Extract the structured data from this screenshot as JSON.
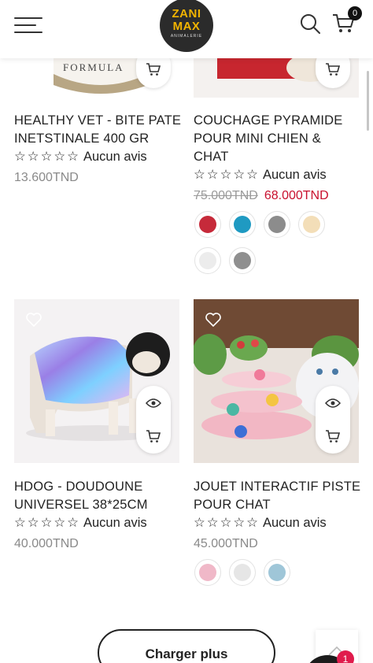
{
  "header": {
    "logo_line1": "ZANI",
    "logo_line2": "MAX",
    "logo_line3": "ANIMALERIE",
    "cart_count": "0"
  },
  "products": [
    {
      "name": "HEALTHY VET - BITE PATE INETSTINALE 400 GR",
      "image_text": "FORMULA",
      "stars": "☆☆☆☆☆",
      "reviews": "Aucun avis",
      "price": "13.600TND"
    },
    {
      "name": "COUCHAGE PYRAMIDE POUR MINI CHIEN & CHAT",
      "stars": "☆☆☆☆☆",
      "reviews": "Aucun avis",
      "old_price": "75.000TND",
      "price": "68.000TND",
      "swatch_colors": [
        "#c62a3a",
        "#1f9ac2",
        "#8c8c8c",
        "#f3deb8",
        "#ececec",
        "#8f8f8f"
      ]
    },
    {
      "name": "HDOG - DOUDOUNE UNIVERSEL 38*25CM",
      "stars": "☆☆☆☆☆",
      "reviews": "Aucun avis",
      "price": "40.000TND"
    },
    {
      "name": "JOUET INTERACTIF PISTE POUR CHAT",
      "stars": "☆☆☆☆☆",
      "reviews": "Aucun avis",
      "price": "45.000TND",
      "swatch_colors": [
        "#f0b8c8",
        "#e6e6e6",
        "#9fc6d8"
      ]
    }
  ],
  "load_more_label": "Charger plus",
  "chat_badge": "1",
  "colors": {
    "sale_price": "#c8102e",
    "regular_price": "#8a8a8a",
    "logo_bg": "#2b2b2b",
    "logo_text": "#f2b400"
  }
}
